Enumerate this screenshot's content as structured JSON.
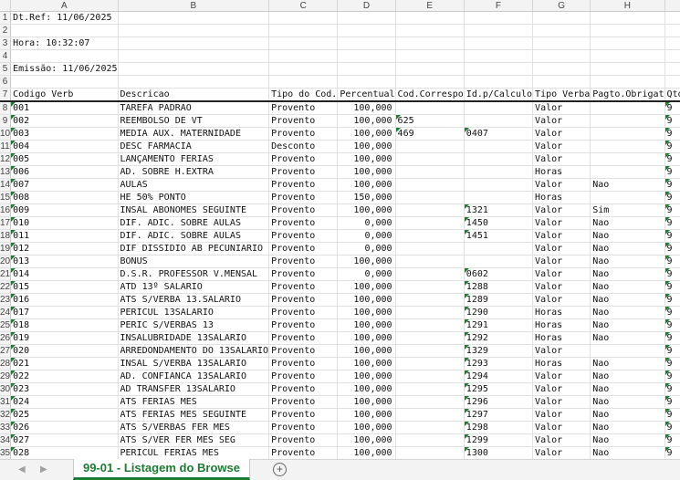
{
  "columns": [
    "A",
    "B",
    "C",
    "D",
    "E",
    "F",
    "G",
    "H",
    "I"
  ],
  "sheet": {
    "tab_name": "99-01 - Listagem do Browse",
    "nav_prev": "◀",
    "nav_next": "▶",
    "add_sheet": "+"
  },
  "rows": [
    {
      "n": "1",
      "A": "Dt.Ref: 11/06/2025"
    },
    {
      "n": "2"
    },
    {
      "n": "3",
      "A": "Hora: 10:32:07"
    },
    {
      "n": "4"
    },
    {
      "n": "5",
      "A": "Emissão: 11/06/2025"
    },
    {
      "n": "6"
    },
    {
      "n": "7",
      "hdr": true,
      "A": "Codigo Verb",
      "B": "Descricao",
      "C": "Tipo do Cod.",
      "D": "Percentual",
      "E": "Cod.Correspo",
      "F": "Id.p/Calculo",
      "G": "Tipo Verba",
      "H": "Pagto.Obrigat",
      "I": "Qtde.Lanctos"
    },
    {
      "n": "8",
      "A": "001",
      "B": "TAREFA PADRAO",
      "C": "Provento",
      "D": "100,000",
      "G": "Valor",
      "I": "9"
    },
    {
      "n": "9",
      "A": "002",
      "B": "REEMBOLSO DE VT",
      "C": "Provento",
      "D": "100,000",
      "E": "625",
      "G": "Valor",
      "I": "9"
    },
    {
      "n": "10",
      "A": "003",
      "B": "MEDIA AUX. MATERNIDADE",
      "C": "Provento",
      "D": "100,000",
      "E": "469",
      "F": "0407",
      "G": "Valor",
      "I": "9"
    },
    {
      "n": "11",
      "A": "004",
      "B": "DESC FARMACIA",
      "C": "Desconto",
      "D": "100,000",
      "G": "Valor",
      "I": "9"
    },
    {
      "n": "12",
      "A": "005",
      "B": "LANÇAMENTO FERIAS",
      "C": "Provento",
      "D": "100,000",
      "G": "Valor",
      "I": "9"
    },
    {
      "n": "13",
      "A": "006",
      "B": "AD. SOBRE H.EXTRA",
      "C": "Provento",
      "D": "100,000",
      "G": "Horas",
      "I": "9"
    },
    {
      "n": "14",
      "A": "007",
      "B": "AULAS",
      "C": "Provento",
      "D": "100,000",
      "G": "Valor",
      "H": "Nao",
      "I": "9"
    },
    {
      "n": "15",
      "A": "008",
      "B": "HE 50% PONTO",
      "C": "Provento",
      "D": "150,000",
      "G": "Horas",
      "I": "9"
    },
    {
      "n": "16",
      "A": "009",
      "B": "INSAL ABONOMES SEGUINTE",
      "C": "Provento",
      "D": "100,000",
      "F": "1321",
      "G": "Valor",
      "H": "Sim",
      "I": "9"
    },
    {
      "n": "17",
      "A": "010",
      "B": "DIF. ADIC. SOBRE AULAS",
      "C": "Provento",
      "D": "0,000",
      "F": "1450",
      "G": "Valor",
      "H": "Nao",
      "I": "9"
    },
    {
      "n": "18",
      "A": "011",
      "B": "DIF. ADIC. SOBRE AULAS",
      "C": "Provento",
      "D": "0,000",
      "F": "1451",
      "G": "Valor",
      "H": "Nao",
      "I": "9"
    },
    {
      "n": "19",
      "A": "012",
      "B": "DIF DISSIDIO AB PECUNIARIO",
      "C": "Provento",
      "D": "0,000",
      "G": "Valor",
      "H": "Nao",
      "I": "9"
    },
    {
      "n": "20",
      "A": "013",
      "B": "BONUS",
      "C": "Provento",
      "D": "100,000",
      "G": "Valor",
      "H": "Nao",
      "I": "9"
    },
    {
      "n": "21",
      "A": "014",
      "B": "D.S.R. PROFESSOR V.MENSAL",
      "C": "Provento",
      "D": "0,000",
      "F": "0602",
      "G": "Valor",
      "H": "Nao",
      "I": "9"
    },
    {
      "n": "22",
      "A": "015",
      "B": "ATD 13º SALARIO",
      "C": "Provento",
      "D": "100,000",
      "F": "1288",
      "G": "Valor",
      "H": "Nao",
      "I": "9"
    },
    {
      "n": "23",
      "A": "016",
      "B": "ATS S/VERBA 13.SALARIO",
      "C": "Provento",
      "D": "100,000",
      "F": "1289",
      "G": "Valor",
      "H": "Nao",
      "I": "9"
    },
    {
      "n": "24",
      "A": "017",
      "B": "PERICUL 13SALARIO",
      "C": "Provento",
      "D": "100,000",
      "F": "1290",
      "G": "Horas",
      "H": "Nao",
      "I": "9"
    },
    {
      "n": "25",
      "A": "018",
      "B": "PERIC S/VERBAS 13",
      "C": "Provento",
      "D": "100,000",
      "F": "1291",
      "G": "Horas",
      "H": "Nao",
      "I": "9"
    },
    {
      "n": "26",
      "A": "019",
      "B": "INSALUBRIDADE 13SALARIO",
      "C": "Provento",
      "D": "100,000",
      "F": "1292",
      "G": "Horas",
      "H": "Nao",
      "I": "9"
    },
    {
      "n": "27",
      "A": "020",
      "B": "ARREDONDAMENTO DO 13SALARIO",
      "C": "Provento",
      "D": "100,000",
      "F": "1329",
      "G": "Valor",
      "I": "9"
    },
    {
      "n": "28",
      "A": "021",
      "B": "INSAL S/VERBA 13SALARIO",
      "C": "Provento",
      "D": "100,000",
      "F": "1293",
      "G": "Horas",
      "H": "Nao",
      "I": "9"
    },
    {
      "n": "29",
      "A": "022",
      "B": "AD. CONFIANCA 13SALARIO",
      "C": "Provento",
      "D": "100,000",
      "F": "1294",
      "G": "Valor",
      "H": "Nao",
      "I": "9"
    },
    {
      "n": "30",
      "A": "023",
      "B": "AD TRANSFER 13SALARIO",
      "C": "Provento",
      "D": "100,000",
      "F": "1295",
      "G": "Valor",
      "H": "Nao",
      "I": "9"
    },
    {
      "n": "31",
      "A": "024",
      "B": "ATS FERIAS MES",
      "C": "Provento",
      "D": "100,000",
      "F": "1296",
      "G": "Valor",
      "H": "Nao",
      "I": "9"
    },
    {
      "n": "32",
      "A": "025",
      "B": "ATS FERIAS MES SEGUINTE",
      "C": "Provento",
      "D": "100,000",
      "F": "1297",
      "G": "Valor",
      "H": "Nao",
      "I": "9"
    },
    {
      "n": "33",
      "A": "026",
      "B": "ATS S/VERBAS FER MES",
      "C": "Provento",
      "D": "100,000",
      "F": "1298",
      "G": "Valor",
      "H": "Nao",
      "I": "9"
    },
    {
      "n": "34",
      "A": "027",
      "B": "ATS S/VER FER MES SEG",
      "C": "Provento",
      "D": "100,000",
      "F": "1299",
      "G": "Valor",
      "H": "Nao",
      "I": "9"
    },
    {
      "n": "35",
      "A": "028",
      "B": "PERICUL FERIAS MES",
      "C": "Provento",
      "D": "100,000",
      "F": "1300",
      "G": "Valor",
      "H": "Nao",
      "I": "9"
    }
  ]
}
